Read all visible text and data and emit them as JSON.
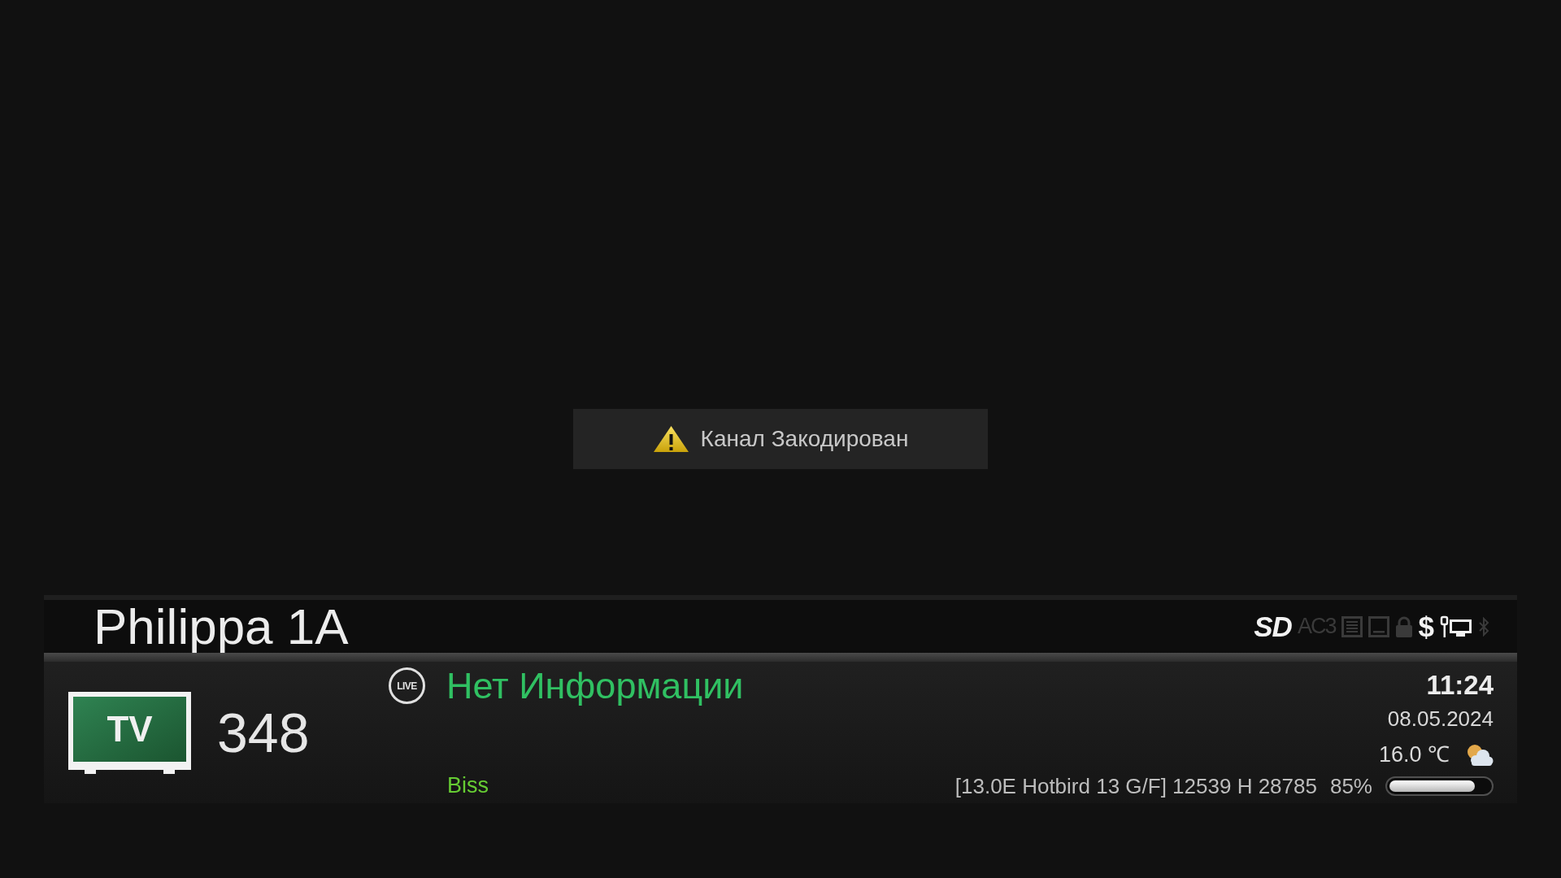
{
  "notification": {
    "text": "Канал Закодирован"
  },
  "infobar": {
    "channel_name": "Philippa 1A",
    "indicators": [
      {
        "kind": "video_format",
        "label": "SD",
        "on": true
      },
      {
        "kind": "audio_format",
        "label": "AC3",
        "on": false
      },
      {
        "kind": "teletext",
        "on": false
      },
      {
        "kind": "subtitles",
        "on": false
      },
      {
        "kind": "lock",
        "on": false
      },
      {
        "kind": "currency",
        "label": "$",
        "on": true
      },
      {
        "kind": "network",
        "on": true
      },
      {
        "kind": "bluetooth",
        "on": false
      }
    ],
    "service_type": "TV",
    "channel_number": "348",
    "live_badge": "LIVE",
    "event_title": "Нет Информации",
    "encryption": "Biss",
    "time": "11:24",
    "date": "08.05.2024",
    "temperature": "16.0 ℃",
    "tuner_info": "[13.0E Hotbird 13 G/F] 12539 H 28785",
    "signal": {
      "reading": "85%",
      "level": 0.85
    }
  }
}
